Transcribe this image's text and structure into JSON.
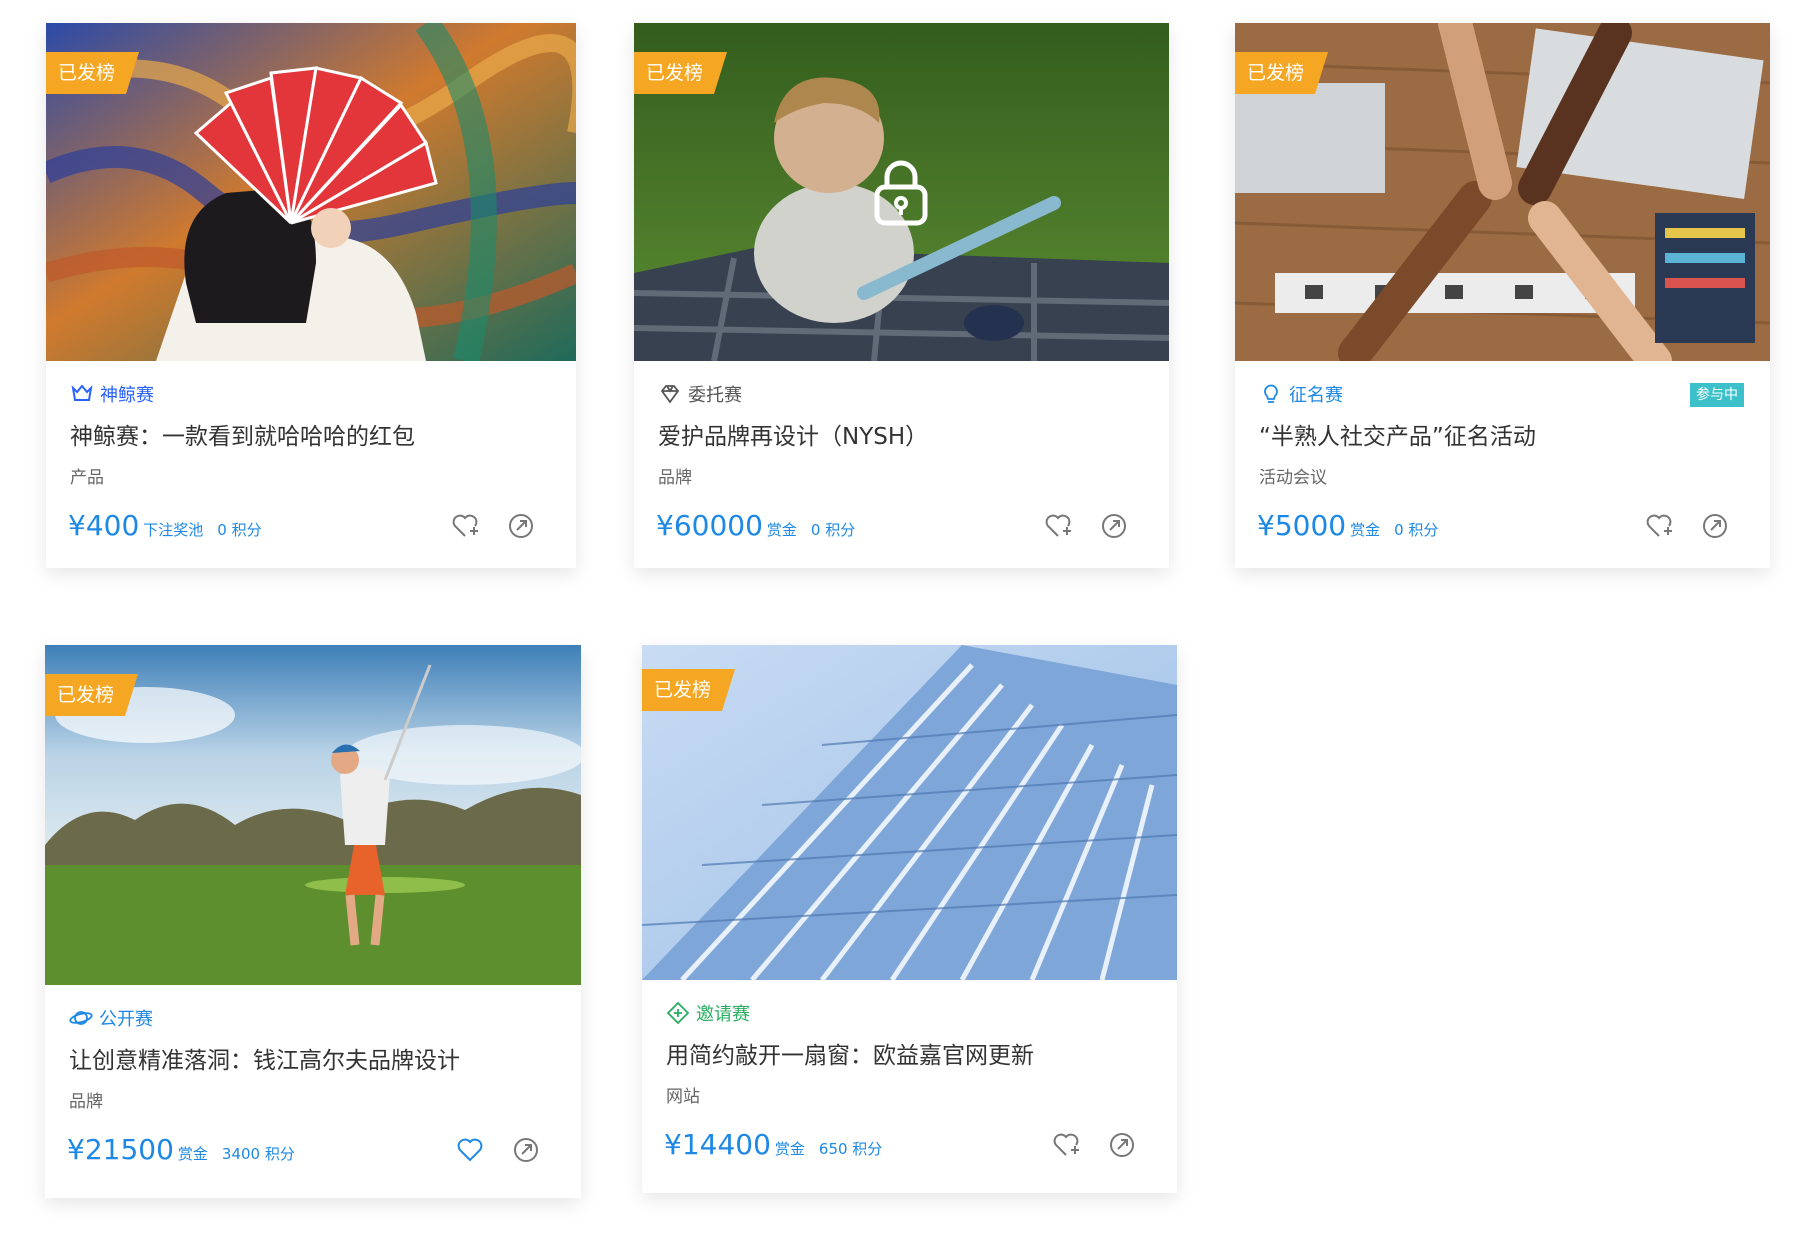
{
  "colors": {
    "accent": "#1e88e5",
    "ribbon": "#f5a623",
    "status": "#3cc0c9",
    "invite": "#27ae60"
  },
  "cards": [
    {
      "badge": "已发榜",
      "type_label": "神鲸赛",
      "type_icon": "whale-crown-icon",
      "type_color": "#2962ff",
      "title": "神鲸赛：一款看到就哈哈哈的红包",
      "category": "产品",
      "price": "¥400",
      "price_unit": "下注奖池",
      "points": "0 积分"
    },
    {
      "badge": "已发榜",
      "type_label": "委托赛",
      "type_icon": "diamond-icon",
      "type_color": "#555555",
      "title": "爱护品牌再设计（NYSH）",
      "category": "品牌",
      "price": "¥60000",
      "price_unit": "赏金",
      "points": "0 积分"
    },
    {
      "badge": "已发榜",
      "type_label": "征名赛",
      "type_icon": "lightbulb-icon",
      "type_color": "#1e88e5",
      "status": "参与中",
      "title": "“半熟人社交产品”征名活动",
      "category": "活动会议",
      "price": "¥5000",
      "price_unit": "赏金",
      "points": "0 积分"
    },
    {
      "badge": "已发榜",
      "type_label": "公开赛",
      "type_icon": "planet-icon",
      "type_color": "#1e88e5",
      "title": "让创意精准落洞：钱江高尔夫品牌设计",
      "category": "品牌",
      "price": "¥21500",
      "price_unit": "赏金",
      "points": "3400 积分"
    },
    {
      "badge": "已发榜",
      "type_label": "邀请赛",
      "type_icon": "invite-ticket-icon",
      "type_color": "#27ae60",
      "title": "用简约敲开一扇窗：欧益嘉官网更新",
      "category": "网站",
      "price": "¥14400",
      "price_unit": "赏金",
      "points": "650 积分"
    }
  ]
}
